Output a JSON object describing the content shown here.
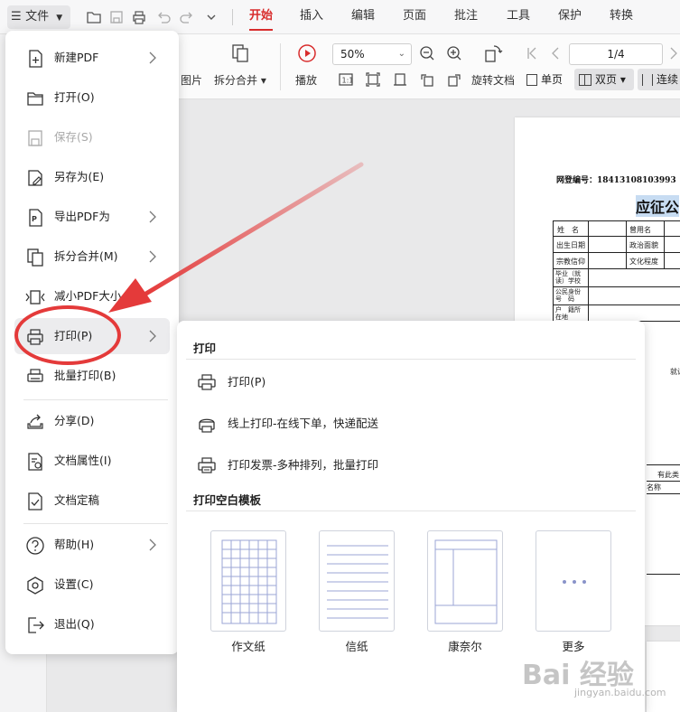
{
  "menubar": {
    "file_label": "文件",
    "tabs": [
      "开始",
      "插入",
      "编辑",
      "页面",
      "批注",
      "工具",
      "保护",
      "转换"
    ],
    "active_tab": "开始"
  },
  "toolbar": {
    "image_label": "图片",
    "split_merge_label": "拆分合并",
    "play_label": "播放",
    "zoom_value": "50%",
    "rotate_label": "旋转文档",
    "page_indicator": "1/4",
    "single_page_label": "单页",
    "double_page_label": "双页",
    "continuous_label": "连续"
  },
  "file_menu": {
    "items": [
      {
        "label": "新建PDF",
        "icon": "new-pdf-icon",
        "has_submenu": true,
        "disabled": false
      },
      {
        "label": "打开(O)",
        "icon": "folder-icon",
        "has_submenu": false,
        "disabled": false
      },
      {
        "label": "保存(S)",
        "icon": "save-icon",
        "has_submenu": false,
        "disabled": true
      },
      {
        "label": "另存为(E)",
        "icon": "save-as-icon",
        "has_submenu": false,
        "disabled": false
      },
      {
        "label": "导出PDF为",
        "icon": "export-pdf-icon",
        "has_submenu": true,
        "disabled": false
      },
      {
        "label": "拆分合并(M)",
        "icon": "split-merge-icon",
        "has_submenu": true,
        "disabled": false
      },
      {
        "label": "减小PDF大小",
        "icon": "compress-icon",
        "has_submenu": false,
        "disabled": false
      },
      {
        "label": "打印(P)",
        "icon": "printer-icon",
        "has_submenu": true,
        "disabled": false,
        "hover": true
      },
      {
        "label": "批量打印(B)",
        "icon": "batch-print-icon",
        "has_submenu": false,
        "disabled": false
      },
      {
        "label": "分享(D)",
        "icon": "share-icon",
        "has_submenu": false,
        "disabled": false
      },
      {
        "label": "文档属性(I)",
        "icon": "doc-properties-icon",
        "has_submenu": false,
        "disabled": false
      },
      {
        "label": "文档定稿",
        "icon": "finalize-icon",
        "has_submenu": false,
        "disabled": false
      },
      {
        "label": "帮助(H)",
        "icon": "help-icon",
        "has_submenu": true,
        "disabled": false
      },
      {
        "label": "设置(C)",
        "icon": "settings-icon",
        "has_submenu": false,
        "disabled": false
      },
      {
        "label": "退出(Q)",
        "icon": "exit-icon",
        "has_submenu": false,
        "disabled": false
      }
    ]
  },
  "print_submenu": {
    "section_print": "打印",
    "items": [
      {
        "label": "打印(P)",
        "icon": "printer-icon"
      },
      {
        "label": "线上打印-在线下单，快递配送",
        "icon": "online-print-icon"
      },
      {
        "label": "打印发票-多种排列，批量打印",
        "icon": "invoice-print-icon"
      }
    ],
    "section_templates": "打印空白模板",
    "templates": [
      {
        "label": "作文纸",
        "icon": "grid-paper-icon"
      },
      {
        "label": "信纸",
        "icon": "lined-paper-icon"
      },
      {
        "label": "康奈尔",
        "icon": "cornell-paper-icon"
      },
      {
        "label": "更多",
        "icon": "more-icon"
      }
    ]
  },
  "document": {
    "registration": "网登编号：18413108103993",
    "title_fragment": "应征公",
    "cells": [
      "姓　名",
      "曾用名",
      "出生日期",
      "政治面貌",
      "宗教信仰",
      "文化程度",
      "毕业（就读）学校",
      "公民身份号　码",
      "户　籍所在地",
      "就读",
      "有此类",
      "名称"
    ]
  },
  "watermark": {
    "brand": "Bai 经验",
    "url": "jingyan.baidu.com"
  },
  "colors": {
    "accent": "#d82c2c",
    "annotation": "#e43a3a"
  }
}
